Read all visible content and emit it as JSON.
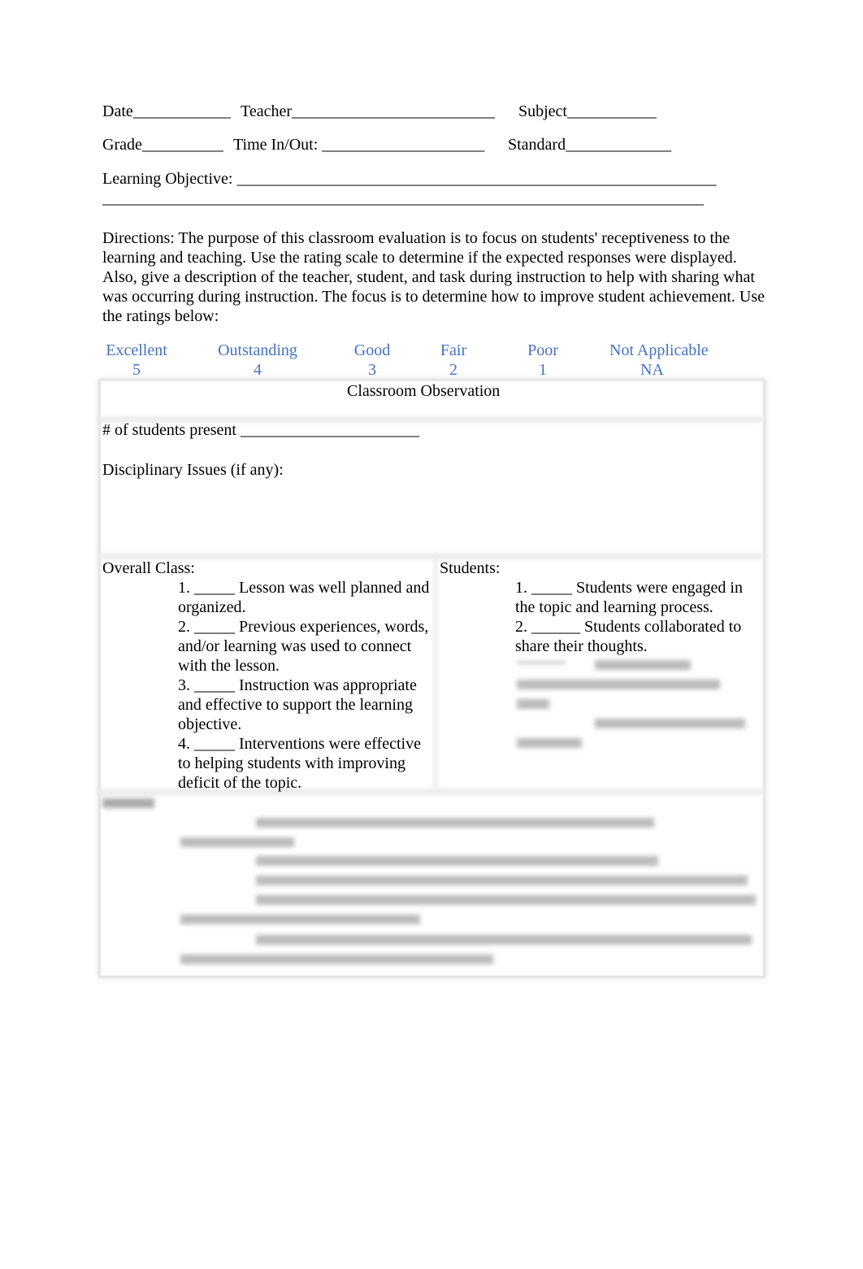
{
  "header": {
    "date": "Date____________",
    "teacher": "Teacher_________________________",
    "subject": "Subject___________",
    "grade": "Grade__________",
    "time": "Time In/Out: ____________________",
    "standard": "Standard_____________",
    "objective": "Learning Objective: ___________________________________________________________",
    "objective_line2": "__________________________________________________________________________"
  },
  "directions": "Directions: The purpose of this classroom evaluation is to focus on students' receptiveness to the learning and teaching. Use the rating scale to determine if the expected responses were displayed. Also, give a description of the teacher, student, and task during instruction to help with sharing what was occurring during instruction. The focus is to determine how to improve student achievement. Use the ratings below:",
  "ratings": [
    {
      "label": "Excellent",
      "value": "5"
    },
    {
      "label": "Outstanding",
      "value": "4"
    },
    {
      "label": "Good",
      "value": "3"
    },
    {
      "label": "Fair",
      "value": "2"
    },
    {
      "label": "Poor",
      "value": "1"
    },
    {
      "label": "Not Applicable",
      "value": "NA"
    }
  ],
  "rating_color": "#4472c4",
  "observation": {
    "title": "Classroom Observation",
    "students_present": "# of students present ______________________",
    "disciplinary": "Disciplinary Issues (if any):",
    "overall_heading": "Overall Class:",
    "overall_items": [
      "1.   _____ Lesson was well planned and organized.",
      "2.   _____ Previous experiences, words, and/or learning was used to connect with the lesson.",
      "3.   _____ Instruction was appropriate and effective to support the learning objective.",
      "4.   _____ Interventions were effective to helping students with improving deficit of the topic."
    ],
    "students_heading": "Students:",
    "students_items": [
      "1.   _____ Students were engaged in the topic and learning process.",
      "2.   ______ Students collaborated to share their thoughts."
    ]
  }
}
